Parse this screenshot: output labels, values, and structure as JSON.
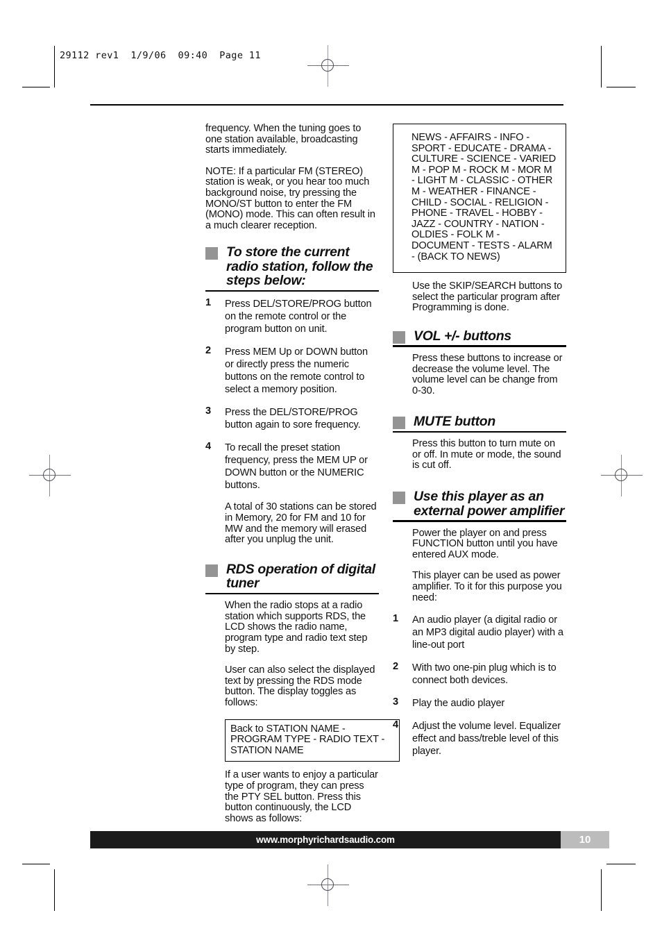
{
  "printer_slug": "29112 rev1  1/9/06  09:40  Page 11",
  "left_column": {
    "intro_paragraphs": [
      "frequency. When the tuning goes to one station available, broadcasting starts immediately.",
      "NOTE: If a particular FM (STEREO) station is weak, or you hear too much background noise, try pressing the MONO/ST button to enter the FM (MONO) mode. This can often result in a much clearer reception."
    ],
    "store_section": {
      "heading": "To store the current radio station, follow the steps below:",
      "steps": [
        {
          "num": "1",
          "text": "Press DEL/STORE/PROG button on the remote control or the program button on unit."
        },
        {
          "num": "2",
          "text": "Press MEM Up or DOWN button or directly press the numeric buttons on the remote control to select a memory position."
        },
        {
          "num": "3",
          "text": "Press the DEL/STORE/PROG button again to sore frequency."
        },
        {
          "num": "4",
          "text": "To recall the preset station frequency, press the MEM UP or DOWN button or the NUMERIC buttons."
        }
      ],
      "closing_note": "A total of 30 stations can be stored in Memory, 20 for FM and 10 for MW and the memory will erased after you unplug the unit."
    },
    "rds_section": {
      "heading": "RDS operation of digital tuner",
      "paragraphs": [
        "When the radio stops at a radio station which supports RDS, the LCD shows the radio name, program type and radio text step by step.",
        "User can also select the displayed text by pressing the RDS mode button. The display toggles as follows:"
      ],
      "toggle_box": "Back to STATION NAME - PROGRAM TYPE - RADIO TEXT - STATION NAME",
      "closing_paragraph": "If a user wants to enjoy a particular type of program, they can press the PTY SEL button. Press this button continuously, the LCD shows as follows:"
    }
  },
  "right_column": {
    "pty_list_box": "NEWS - AFFAIRS - INFO - SPORT - EDUCATE - DRAMA - CULTURE - SCIENCE - VARIED M - POP M - ROCK M - MOR M - LIGHT M - CLASSIC - OTHER M - WEATHER - FINANCE - CHILD - SOCIAL - RELIGION - PHONE - TRAVEL - HOBBY - JAZZ - COUNTRY - NATION - OLDIES - FOLK M - DOCUMENT - TESTS - ALARM - (BACK TO NEWS)",
    "skip_search_note": "Use the SKIP/SEARCH buttons to select the particular program after Programming is done.",
    "vol_section": {
      "heading": "VOL +/- buttons",
      "paragraph": "Press these buttons to increase or decrease the volume level. The volume level can be change from 0-30."
    },
    "mute_section": {
      "heading": "MUTE button",
      "paragraph": "Press this button to turn mute on or off. In mute or mode, the sound is cut off."
    },
    "amp_section": {
      "heading": "Use this player as an external power amplifier",
      "paragraphs": [
        "Power the player on and press FUNCTION button until you have entered AUX mode.",
        "This player can be used as power amplifier. To it for this purpose you need:"
      ],
      "steps": [
        {
          "num": "1",
          "text": "An audio player (a digital radio or an MP3 digital audio player) with a line-out port"
        },
        {
          "num": "2",
          "text": "With two one-pin plug which is to connect both devices."
        },
        {
          "num": "3",
          "text": "Play the audio player"
        },
        {
          "num": "4",
          "text": "Adjust the volume level. Equalizer effect and bass/treble level of this player."
        }
      ]
    }
  },
  "footer": {
    "website": "www.morphyrichardsaudio.com",
    "page_number": "10"
  },
  "colors": {
    "heading_bullet": "#949494",
    "footer_bar": "#1b1b1b",
    "page_box": "#bcbcbc"
  }
}
